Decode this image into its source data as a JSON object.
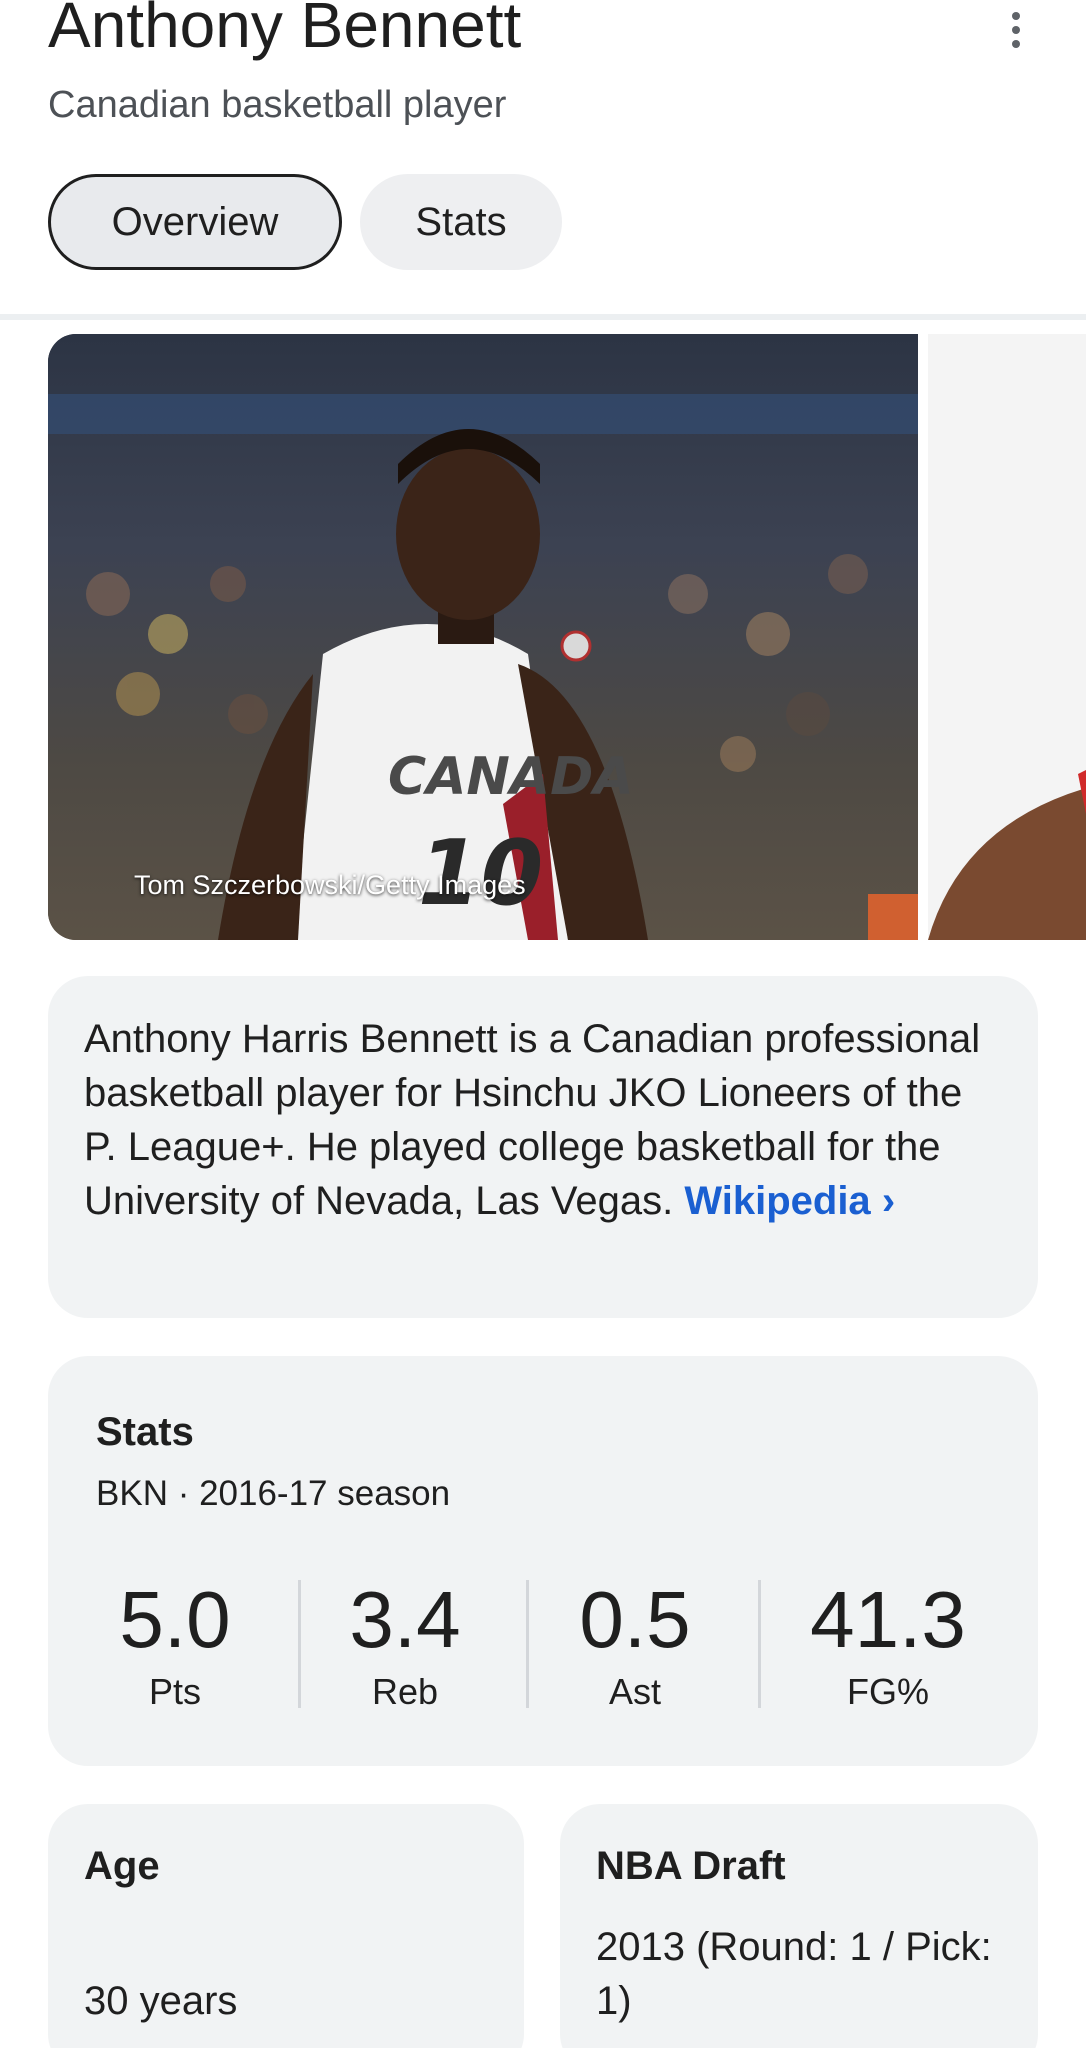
{
  "header": {
    "title": "Anthony Bennett",
    "subtitle": "Canadian basketball player",
    "tabs": [
      {
        "label": "Overview"
      },
      {
        "label": "Stats"
      }
    ]
  },
  "image": {
    "credit": "Tom Szczerbowski/Getty Images"
  },
  "description": {
    "text": "Anthony Harris Bennett is a Canadian professional basketball player for Hsinchu JKO Lioneers of the P. League+. He played college basketball for the University of Nevada, Las Vegas.",
    "link_label": "Wikipedia",
    "link_chevron": "›"
  },
  "stats": {
    "title": "Stats",
    "subtitle": "BKN · 2016-17 season",
    "items": [
      {
        "value": "5.0",
        "label": "Pts"
      },
      {
        "value": "3.4",
        "label": "Reb"
      },
      {
        "value": "0.5",
        "label": "Ast"
      },
      {
        "value": "41.3",
        "label": "FG%"
      }
    ]
  },
  "facts": {
    "age": {
      "label": "Age",
      "value": "30 years"
    },
    "draft": {
      "label": "NBA Draft",
      "value": "2013 (Round: 1 / Pick: 1)"
    }
  },
  "colors": {
    "link": "#1a5fd1",
    "card_bg": "#f1f3f4"
  }
}
